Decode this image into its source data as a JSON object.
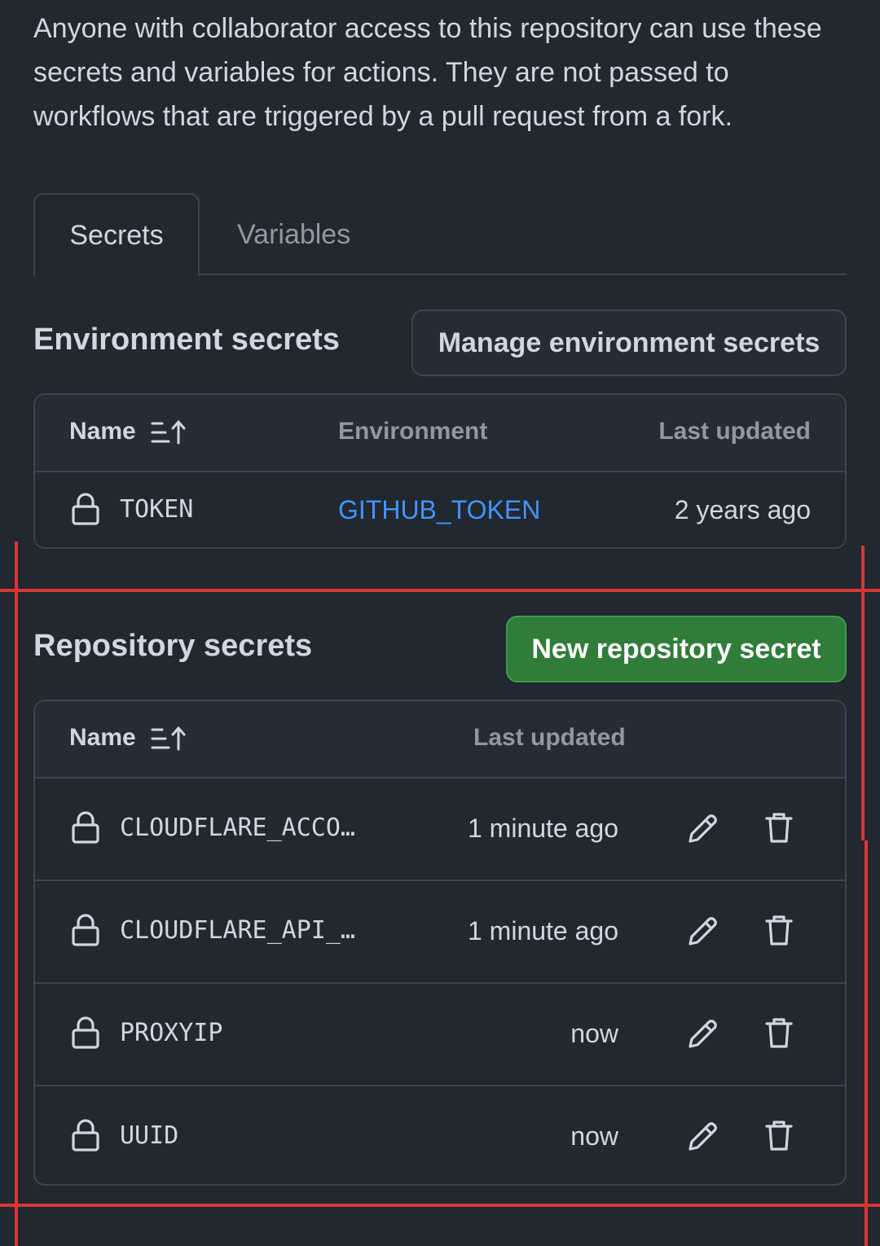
{
  "intro_text": "Anyone with collaborator access to this repository can use these secrets and variables for actions. They are not passed to workflows that are triggered by a pull request from a fork.",
  "tabs": [
    {
      "label": "Secrets",
      "active": true
    },
    {
      "label": "Variables",
      "active": false
    }
  ],
  "environment_secrets": {
    "title": "Environment secrets",
    "manage_button": "Manage environment secrets",
    "columns": {
      "name": "Name",
      "environment": "Environment",
      "last_updated": "Last updated"
    },
    "rows": [
      {
        "name": "TOKEN",
        "environment": "GITHUB_TOKEN",
        "last_updated": "2 years ago"
      }
    ]
  },
  "repository_secrets": {
    "title": "Repository secrets",
    "new_button": "New repository secret",
    "columns": {
      "name": "Name",
      "last_updated": "Last updated"
    },
    "rows": [
      {
        "name": "CLOUDFLARE_ACCO…",
        "last_updated": "1 minute ago"
      },
      {
        "name": "CLOUDFLARE_API_…",
        "last_updated": "1 minute ago"
      },
      {
        "name": "PROXYIP",
        "last_updated": "now"
      },
      {
        "name": "UUID",
        "last_updated": "now"
      }
    ]
  },
  "icons": {
    "sort": "sort-ascending-icon",
    "lock": "lock-icon",
    "edit": "pencil-icon",
    "delete": "trash-icon"
  },
  "colors": {
    "background": "#212830",
    "link": "#4493f8",
    "primary_button": "#2f7d39",
    "annotation": "#d93636"
  }
}
